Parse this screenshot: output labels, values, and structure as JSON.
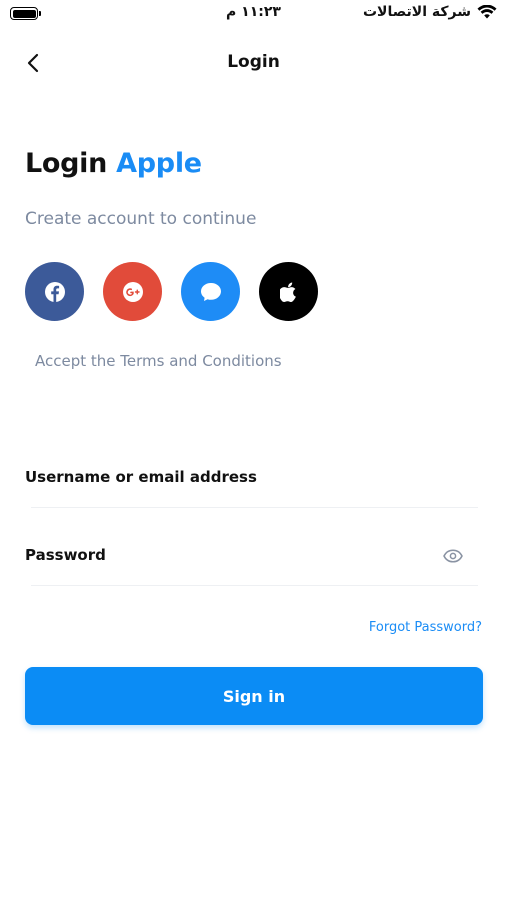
{
  "status_bar": {
    "time": "١١:٢٣ م",
    "carrier": "شركة الاتصالات"
  },
  "nav": {
    "title": "Login"
  },
  "heading": {
    "prefix": "Login",
    "brand": "Apple"
  },
  "subtitle": "Create account to continue",
  "social": [
    {
      "name": "facebook",
      "icon": "facebook-icon",
      "color": "#3c5a99"
    },
    {
      "name": "google-plus",
      "icon": "google-plus-icon",
      "color": "#e14b3a"
    },
    {
      "name": "messenger",
      "icon": "chat-bubble-icon",
      "color": "#1e8cf6"
    },
    {
      "name": "apple",
      "icon": "apple-icon",
      "color": "#000000"
    }
  ],
  "terms": "Accept the Terms and Conditions",
  "form": {
    "username_label": "Username or email address",
    "username_value": "",
    "password_label": "Password",
    "password_value": "",
    "forgot": "Forgot Password?",
    "submit": "Sign in"
  },
  "colors": {
    "accent": "#1a8cf5",
    "button": "#0b8cf5",
    "muted": "#7d8aa0"
  }
}
